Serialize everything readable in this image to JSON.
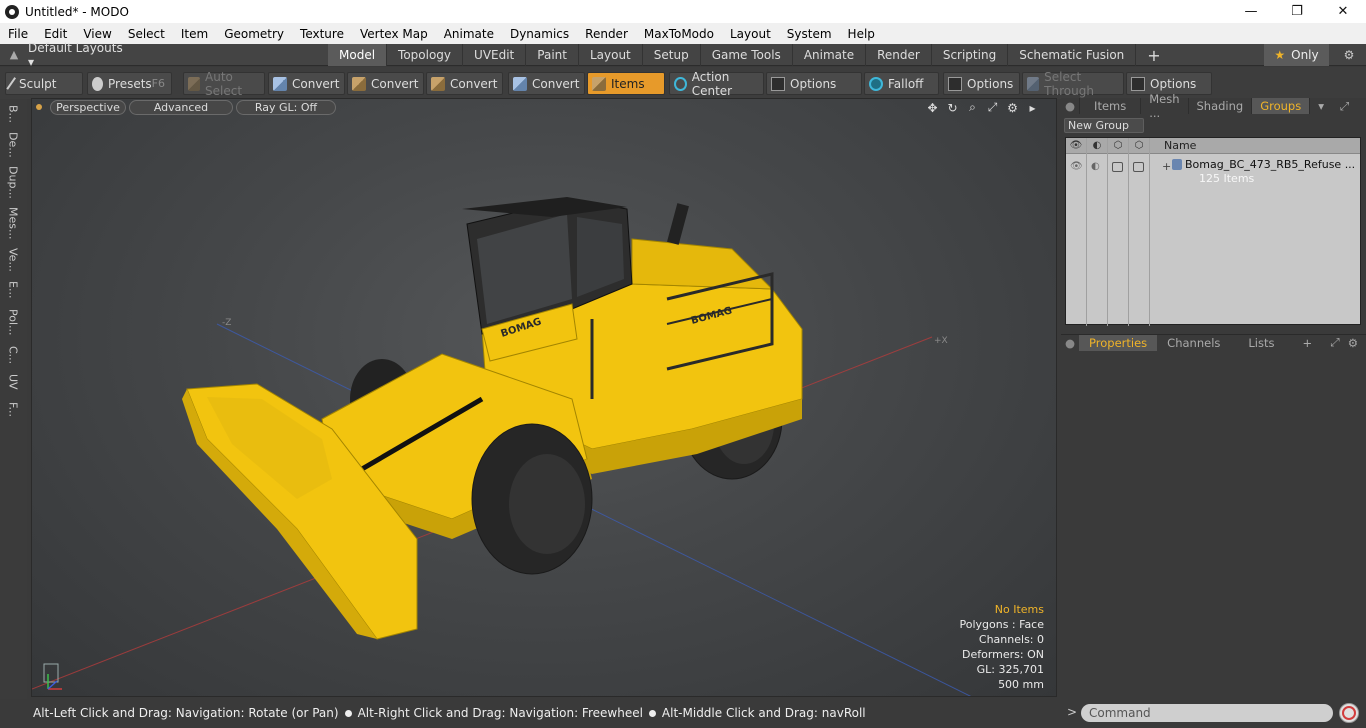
{
  "window": {
    "title": "Untitled* - MODO",
    "controls": [
      "—",
      "❐",
      "✕"
    ]
  },
  "menu": [
    "File",
    "Edit",
    "View",
    "Select",
    "Item",
    "Geometry",
    "Texture",
    "Vertex Map",
    "Animate",
    "Dynamics",
    "Render",
    "MaxToModo",
    "Layout",
    "System",
    "Help"
  ],
  "layout_bar": {
    "layout_select": "Default Layouts ▾",
    "tabs": [
      "Model",
      "Topology",
      "UVEdit",
      "Paint",
      "Layout",
      "Setup",
      "Game Tools",
      "Animate",
      "Render",
      "Scripting",
      "Schematic Fusion"
    ],
    "active_tab": "Model",
    "only_label": "Only"
  },
  "toolbar": {
    "sculpt": "Sculpt",
    "presets": "Presets",
    "presets_key": "F6",
    "auto_select": "Auto Select",
    "convert_1": "Convert",
    "convert_2": "Convert",
    "convert_3": "Convert",
    "convert_4": "Convert",
    "items": "Items",
    "action_center": "Action Center",
    "options_1": "Options",
    "falloff": "Falloff",
    "options_2": "Options",
    "select_through": "Select Through",
    "options_3": "Options"
  },
  "left_strip": [
    "B...",
    "De...",
    "Dup...",
    "Mes...",
    "Ve...",
    "E...",
    "Pol...",
    "C...",
    "UV",
    "F..."
  ],
  "viewport": {
    "perspective": "Perspective",
    "advanced": "Advanced",
    "raygl": "Ray GL: Off",
    "stats": {
      "selection": "No Items",
      "polygons": "Polygons : Face",
      "channels": "Channels: 0",
      "deformers": "Deformers: ON",
      "gl": "GL: 325,701",
      "scale": "500 mm"
    },
    "model_brand_label": "BOMAG"
  },
  "statusbar": {
    "hint_1": "Alt-Left Click and Drag: Navigation: Rotate (or Pan)",
    "hint_2": "Alt-Right Click and Drag: Navigation: Freewheel",
    "hint_3": "Alt-Middle Click and Drag: navRoll"
  },
  "right_panel": {
    "tabs": [
      "Items",
      "Mesh ...",
      "Shading",
      "Groups"
    ],
    "active_tab": "Groups",
    "new_group": "New Group",
    "name_header": "Name",
    "group_row": {
      "name": "Bomag_BC_473_RB5_Refuse ...",
      "count": "125 Items",
      "expand": "+"
    },
    "lower_tabs": [
      "Properties",
      "Channels",
      "Lists"
    ],
    "lower_active": "Properties"
  },
  "command": {
    "placeholder": "Command",
    "prompt": ">"
  },
  "colors": {
    "accent": "#f0b429",
    "machine_yellow": "#f2c40f",
    "tire": "#2c2c2c",
    "grid_red": "#b33c3c",
    "grid_blue": "#3c5cb3"
  }
}
